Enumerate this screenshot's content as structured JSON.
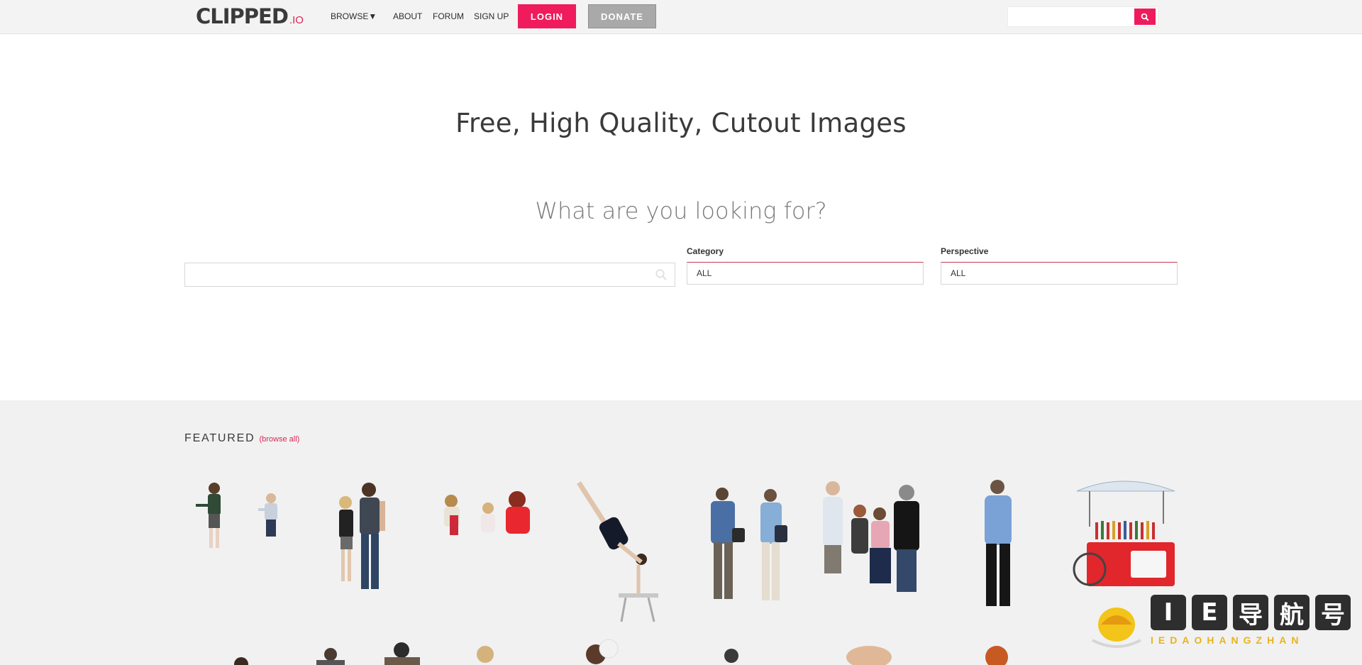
{
  "nav": {
    "logo_main": "CLIPPED",
    "logo_suffix": ".IO",
    "browse": "BROWSE",
    "about": "ABOUT",
    "forum": "FORUM",
    "signup": "SIGN UP",
    "login": "LOGIN",
    "donate": "DONATE",
    "search_placeholder": ""
  },
  "hero": {
    "title": "Free, High Quality, Cutout Images",
    "subtitle": "What are you looking for?",
    "search_placeholder": "",
    "category_label": "Category",
    "category_value": "ALL",
    "perspective_label": "Perspective",
    "perspective_value": "ALL"
  },
  "featured": {
    "title": "FEATURED",
    "browse_all": "(browse all)",
    "items": [
      {
        "name": "two kids playing"
      },
      {
        "name": "couple walking"
      },
      {
        "name": "three women sitting"
      },
      {
        "name": "gymnast on bars"
      },
      {
        "name": "two men walking"
      },
      {
        "name": "group of people talking"
      },
      {
        "name": "man walking away"
      },
      {
        "name": "ice cream cart"
      }
    ]
  },
  "watermark": {
    "chars": [
      "I",
      "E",
      "导",
      "航",
      "号"
    ],
    "sub": "IEDAOHANGZHAN"
  },
  "colors": {
    "accent": "#ef1b5d",
    "donate": "#a9a9a9",
    "featured_bg": "#f1f1f1",
    "nav_bg": "#f3f3f3"
  }
}
